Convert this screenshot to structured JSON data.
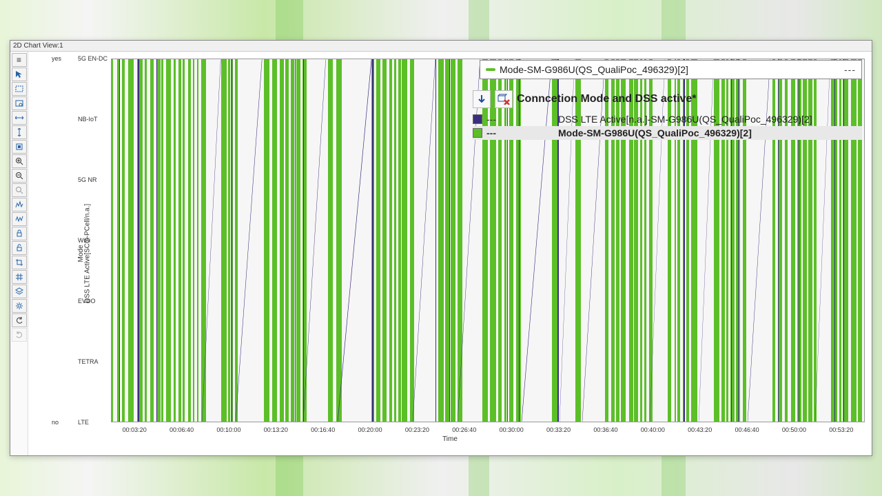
{
  "window": {
    "title": "2D Chart View:1"
  },
  "selector": {
    "label": "Mode-SM-G986U(QS_QualiPoc_496329)[2]",
    "trailing": "---"
  },
  "legend": {
    "title": "Conncetion Mode and DSS active*",
    "rows": [
      {
        "swatch": "purple",
        "dash": "---",
        "label": "DSS LTE Active[n.a.]-SM-G986U(QS_QualiPoc_496329)[2]",
        "selected": false
      },
      {
        "swatch": "green",
        "dash": "---",
        "label": "Mode-SM-G986U(QS_QualiPoc_496329)[2]",
        "selected": true
      }
    ]
  },
  "chart_data": {
    "type": "line",
    "title": "",
    "xlabel": "Time",
    "ylabel_left": "DSS LTE Active[SCG-PCell/n.a.]",
    "ylabel_right": "Mode",
    "x_ticks": [
      "00:03:20",
      "00:06:40",
      "00:10:00",
      "00:13:20",
      "00:16:40",
      "00:20:00",
      "00:23:20",
      "00:26:40",
      "00:30:00",
      "00:33:20",
      "00:36:40",
      "00:40:00",
      "00:43:20",
      "00:46:40",
      "00:50:00",
      "00:53:20"
    ],
    "y_left_categories": [
      "no",
      "yes"
    ],
    "y_right_categories": [
      "LTE",
      "TETRA",
      "EVDO",
      "WiFi",
      "5G NR",
      "NB-IoT",
      "5G EN-DC"
    ],
    "series": [
      {
        "name": "Mode-SM-G986U(QS_QualiPoc_496329)[2]",
        "color": "#5cbf28",
        "note": "Categorical step trace toggling frequently between LTE and 5G EN-DC producing dense vertical green bars across the full time range; brief gaps/idle regions near 00:05, 00:09, 00:12, 00:15, 00:19, 00:22, 00:24, 00:29, 00:31, 00:32, 00:34, 00:38, 00:41, 00:44, 00:48, 00:52."
      },
      {
        "name": "DSS LTE Active[n.a.]-SM-G986U(QS_QualiPoc_496329)[2]",
        "color": "#3b2e7e",
        "note": "Binary trace (no↔yes) drawn as thin dark-purple verticals interleaved with the green bars; transitions occur throughout, with short idle gaps rendered as diagonal connectors at roughly the same positions as the green gaps."
      }
    ]
  },
  "toolbar": {
    "buttons": [
      "menu",
      "pointer",
      "select-rect",
      "zoom-rect",
      "zoom-x",
      "zoom-y",
      "zoom-fit",
      "zoom-in",
      "zoom-out",
      "reset-zoom",
      "signal",
      "signal-alt",
      "lock",
      "lock-alt",
      "crop",
      "grid",
      "layers",
      "settings",
      "undo",
      "redo"
    ]
  }
}
